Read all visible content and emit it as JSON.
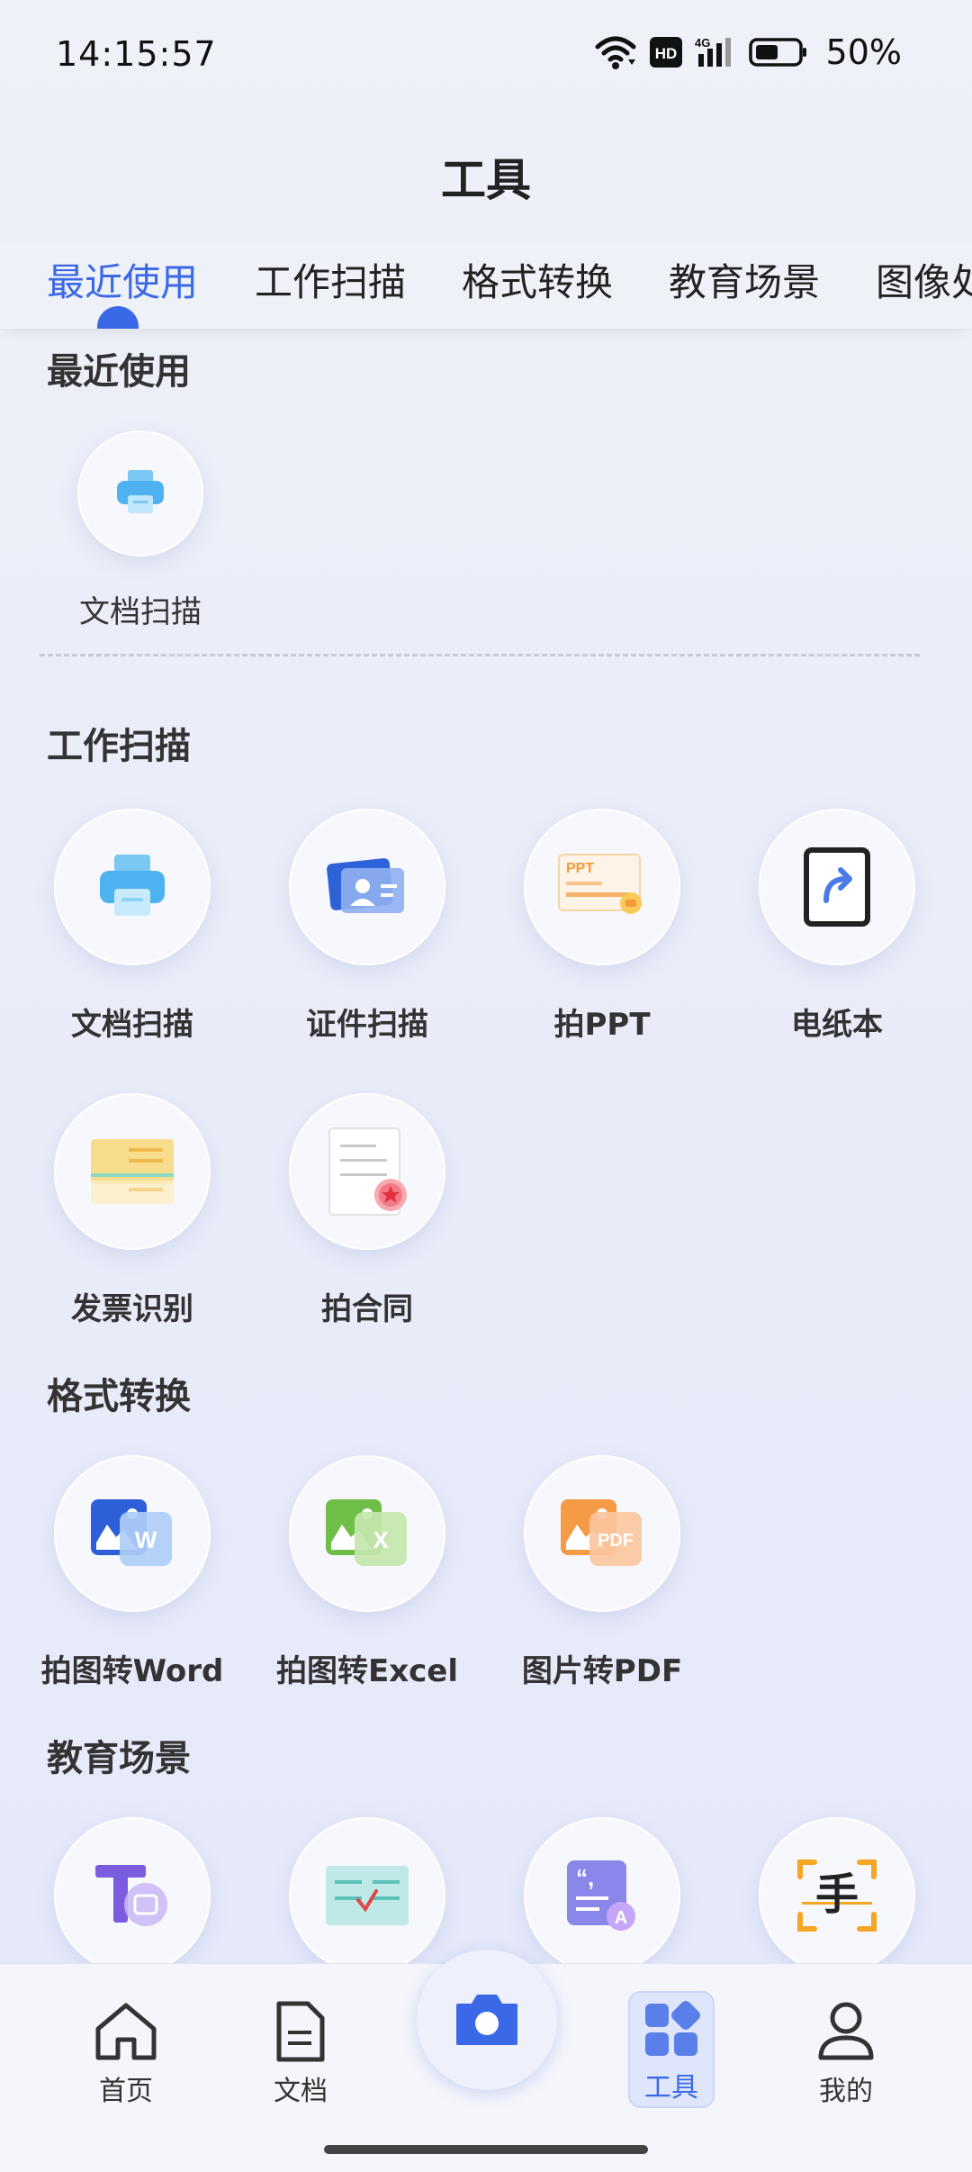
{
  "status_bar": {
    "time": "14:15:57",
    "network_badge": "HD",
    "network_type": "4G",
    "battery": "50%"
  },
  "title": "工具",
  "tabs": [
    {
      "label": "最近使用",
      "active": true
    },
    {
      "label": "工作扫描",
      "active": false
    },
    {
      "label": "格式转换",
      "active": false
    },
    {
      "label": "教育场景",
      "active": false
    },
    {
      "label": "图像处",
      "active": false
    }
  ],
  "sections": {
    "recent": {
      "title": "最近使用",
      "items": [
        {
          "label": "文档扫描",
          "icon": "printer-icon"
        }
      ]
    },
    "work_scan": {
      "title": "工作扫描",
      "items": [
        {
          "label": "文档扫描",
          "icon": "printer-icon"
        },
        {
          "label": "证件扫描",
          "icon": "id-card-icon"
        },
        {
          "label": "拍PPT",
          "icon": "ppt-icon",
          "icon_text": "PPT"
        },
        {
          "label": "电纸本",
          "icon": "tablet-icon"
        },
        {
          "label": "发票识别",
          "icon": "invoice-icon"
        },
        {
          "label": "拍合同",
          "icon": "contract-icon"
        }
      ]
    },
    "format_convert": {
      "title": "格式转换",
      "items": [
        {
          "label": "拍图转Word",
          "icon": "word-icon",
          "icon_text": "W"
        },
        {
          "label": "拍图转Excel",
          "icon": "excel-icon",
          "icon_text": "X"
        },
        {
          "label": "图片转PDF",
          "icon": "pdf-icon",
          "icon_text": "PDF"
        }
      ]
    },
    "education": {
      "title": "教育场景",
      "items": [
        {
          "icon": "text-recognition-icon"
        },
        {
          "icon": "grading-icon"
        },
        {
          "icon": "quote-text-icon"
        },
        {
          "icon": "handwriting-icon",
          "icon_text": "手"
        }
      ]
    }
  },
  "bottom_nav": [
    {
      "label": "首页",
      "icon": "home-icon"
    },
    {
      "label": "文档",
      "icon": "document-icon"
    },
    {
      "label": "",
      "icon": "camera-icon"
    },
    {
      "label": "工具",
      "icon": "tools-icon",
      "active": true
    },
    {
      "label": "我的",
      "icon": "user-icon"
    }
  ],
  "colors": {
    "accent": "#3a68e6",
    "background": "#eef1f8"
  }
}
